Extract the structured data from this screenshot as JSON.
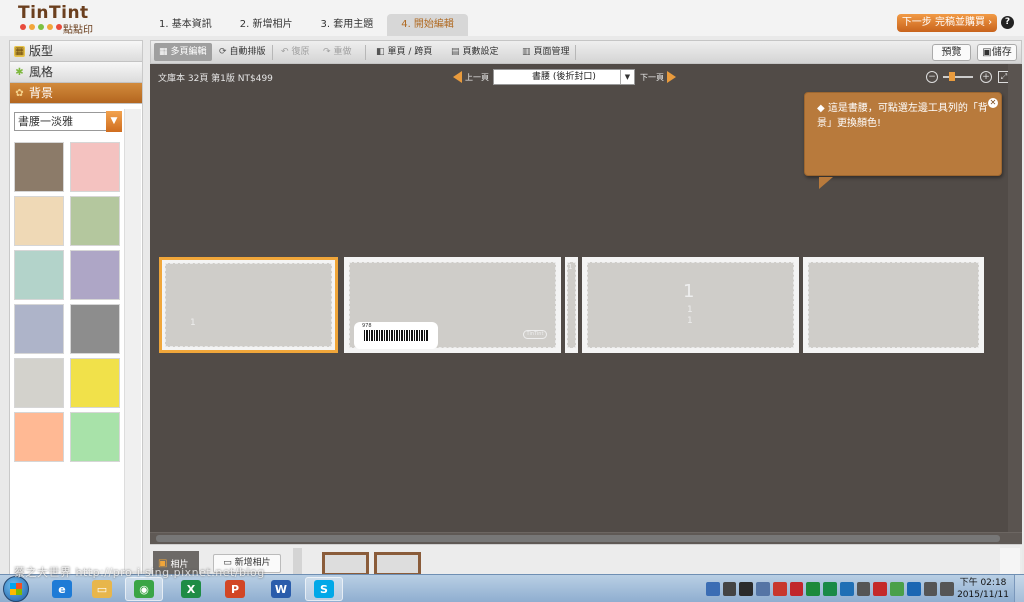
{
  "header": {
    "brand": "TinTint",
    "brand_sub": "點點印",
    "logo_dot_colors": [
      "#e84b3c",
      "#f2a63b",
      "#7cc142",
      "#f2a63b",
      "#e84b3c"
    ],
    "steps": [
      "1. 基本資訊",
      "2. 新增相片",
      "3. 套用主題",
      "4. 開始編輯"
    ],
    "active_step_index": 3,
    "next_button": "下一步 完稿並購買 ›",
    "help_icon": "?"
  },
  "left_panel": {
    "tabs": [
      {
        "label": "版型",
        "icon": "layout-icon",
        "active": false
      },
      {
        "label": "風格",
        "icon": "style-icon",
        "active": false
      },
      {
        "label": "背景",
        "icon": "palette-icon",
        "active": true
      }
    ],
    "background_select": "書腰一淡雅",
    "swatch_colors": [
      "#8c7b69",
      "#f4c2c0",
      "#efd9b6",
      "#b4c79e",
      "#b3d3ca",
      "#aea6c6",
      "#aeb4c9",
      "#8d8d8d",
      "#d3d2cc",
      "#f1e14a",
      "#ffb994",
      "#a8e2a9"
    ]
  },
  "toolbar": {
    "multipage": "多頁編輯",
    "autolayout": "自動排版",
    "undo": "復原",
    "redo": "重做",
    "single_spread": "單頁 / 跨頁",
    "page_settings": "頁數設定",
    "page_manage": "頁面管理",
    "preview": "預覽",
    "save": "儲存"
  },
  "canvas": {
    "book_info": "文庫本 32頁 第1版 NT$499",
    "prev_page": "上一頁",
    "next_page": "下一頁",
    "page_select": "書腰 (後折封口)",
    "colors": {
      "background": "#514b47",
      "accent": "#e99b3d",
      "selection": "#f0a63a"
    },
    "page_numbers": {
      "left_flap": "1",
      "spine": "1",
      "front_big": "1",
      "front_small_1": "1",
      "front_small_2": "1"
    },
    "barcode_text": "978",
    "back_logo": "TinTint",
    "tooltip": "◆ 這是書腰，可點選左邊工具列的「背景」更換顏色!"
  },
  "filmstrip": {
    "photos_label": "相片",
    "add_photos": "新增相片"
  },
  "taskbar": {
    "apps": [
      {
        "name": "ie-icon",
        "glyph": "e",
        "color": "#1e7bd6"
      },
      {
        "name": "explorer-icon",
        "glyph": "▭",
        "color": "#e8b64b"
      },
      {
        "name": "chrome-icon",
        "glyph": "◉",
        "color": "#3aa546",
        "active": true
      },
      {
        "name": "excel-icon",
        "glyph": "X",
        "color": "#1f8c45"
      },
      {
        "name": "powerpoint-icon",
        "glyph": "P",
        "color": "#d24625"
      },
      {
        "name": "word-icon",
        "glyph": "W",
        "color": "#2a5cab"
      },
      {
        "name": "skype-icon",
        "glyph": "S",
        "color": "#00a8e8",
        "active": true
      }
    ],
    "tray_colors": [
      "#3b6db4",
      "#444",
      "#2b2b2b",
      "#5575a5",
      "#c8372d",
      "#c1272d",
      "#1c8a3b",
      "#1a8a47",
      "#1f6fb5",
      "#555",
      "#c42a2a",
      "#4aa049",
      "#1b67b3",
      "#555",
      "#555"
    ],
    "time": "下午 02:18",
    "date": "2015/11/11"
  },
  "watermark": "蔡之大世界 http://pro-i-sing.pixnet.net/blog"
}
